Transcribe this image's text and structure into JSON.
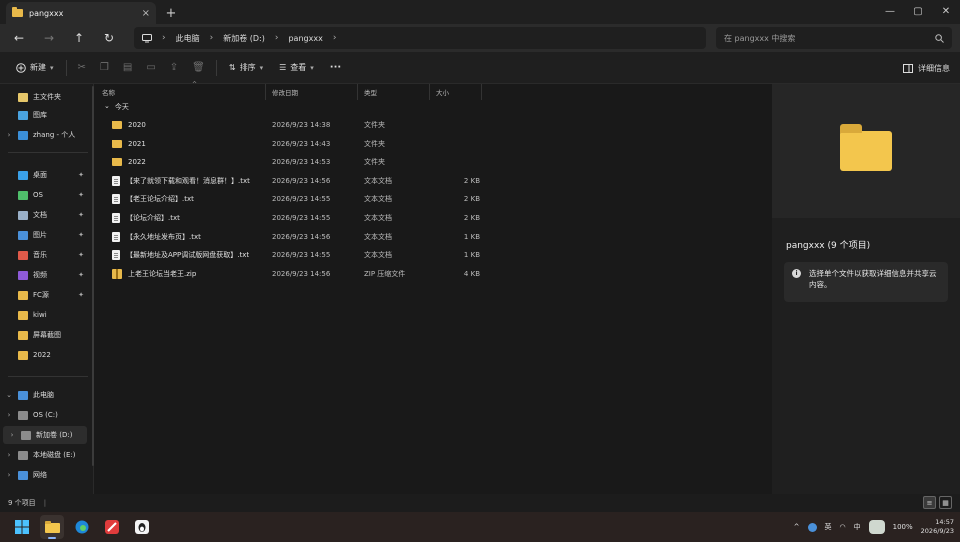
{
  "window": {
    "tab_title": "pangxxx",
    "tab_close": "×",
    "new_tab": "+",
    "controls": {
      "minimize": "—",
      "maximize": "▢",
      "close": "✕"
    }
  },
  "nav": {
    "back": "←",
    "forward": "→",
    "up": "↑",
    "refresh": "↻",
    "breadcrumb": [
      "此电脑",
      "新加卷 (D:)",
      "pangxxx"
    ],
    "search_placeholder": "在 pangxxx 中搜索"
  },
  "commands": {
    "new_label": "新建",
    "sort_label": "排序",
    "view_label": "查看",
    "more_label": "···",
    "details_label": "详细信息"
  },
  "sidebar": {
    "quick": [
      {
        "label": "主文件夹",
        "color": "#e6c76a"
      },
      {
        "label": "图库",
        "color": "#4aa3df"
      },
      {
        "label": "zhang - 个人",
        "color": "#3b8fd8"
      }
    ],
    "pinned": [
      {
        "label": "桌面",
        "color": "#3aa0e8"
      },
      {
        "label": "OS",
        "color": "#4fbf6a"
      },
      {
        "label": "文档",
        "color": "#9ab0c8"
      },
      {
        "label": "图片",
        "color": "#4a90d9"
      },
      {
        "label": "音乐",
        "color": "#e05a4a"
      },
      {
        "label": "视频",
        "color": "#8e5ad8"
      },
      {
        "label": "FC源",
        "color": "#e8b94a"
      },
      {
        "label": "kiwi",
        "color": "#e8b94a"
      },
      {
        "label": "屏幕截图",
        "color": "#e8b94a"
      },
      {
        "label": "2022",
        "color": "#e8b94a"
      }
    ],
    "drives": [
      {
        "label": "此电脑",
        "color": "#4a90d9"
      },
      {
        "label": "OS (C:)",
        "color": "#8c8c8c"
      },
      {
        "label": "新加卷 (D:)",
        "color": "#8c8c8c"
      },
      {
        "label": "本地磁盘 (E:)",
        "color": "#8c8c8c"
      },
      {
        "label": "网络",
        "color": "#4a90d9"
      }
    ]
  },
  "columns": {
    "name": "名称",
    "date": "修改日期",
    "type": "类型",
    "size": "大小"
  },
  "group_label": "今天",
  "files": [
    {
      "icon": "folder",
      "name": "2020",
      "date": "2026/9/23 14:38",
      "type": "文件夹",
      "size": ""
    },
    {
      "icon": "folder",
      "name": "2021",
      "date": "2026/9/23 14:43",
      "type": "文件夹",
      "size": ""
    },
    {
      "icon": "folder",
      "name": "2022",
      "date": "2026/9/23 14:53",
      "type": "文件夹",
      "size": ""
    },
    {
      "icon": "doc",
      "name": "【来了就领下载和观看！消息群！】.txt",
      "date": "2026/9/23 14:56",
      "type": "文本文档",
      "size": "2 KB"
    },
    {
      "icon": "doc",
      "name": "【老王论坛介绍】.txt",
      "date": "2026/9/23 14:55",
      "type": "文本文档",
      "size": "2 KB"
    },
    {
      "icon": "doc",
      "name": "【论坛介绍】.txt",
      "date": "2026/9/23 14:55",
      "type": "文本文档",
      "size": "2 KB"
    },
    {
      "icon": "doc",
      "name": "【永久地址发布页】.txt",
      "date": "2026/9/23 14:56",
      "type": "文本文档",
      "size": "1 KB"
    },
    {
      "icon": "doc",
      "name": "【最新地址及APP调试版网盘获取】.txt",
      "date": "2026/9/23 14:55",
      "type": "文本文档",
      "size": "1 KB"
    },
    {
      "icon": "zip",
      "name": "上老王论坛当老王.zip",
      "date": "2026/9/23 14:56",
      "type": "ZIP 压缩文件",
      "size": "4 KB"
    }
  ],
  "details": {
    "title": "pangxxx (9 个项目)",
    "message": "选择单个文件以获取详细信息并共享云内容。",
    "info_glyph": "i"
  },
  "status": {
    "count": "9 个项目",
    "sep": "|"
  },
  "taskbar": {
    "tray_lang": "英",
    "tray_ime": "中",
    "battery": "100%",
    "time": "14:57",
    "date": "2026/9/23"
  }
}
